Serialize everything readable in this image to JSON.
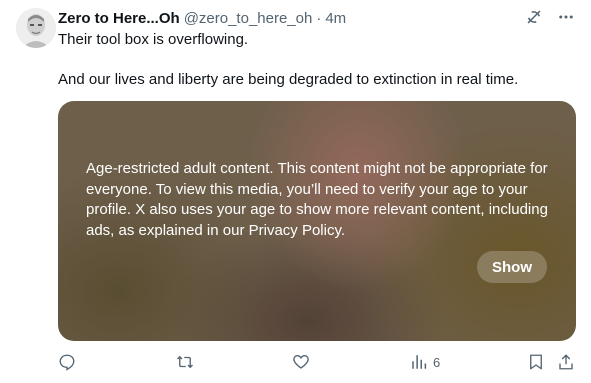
{
  "tweet": {
    "author_name": "Zero to Here...Oh",
    "author_handle": "@zero_to_here_oh",
    "separator": "·",
    "time": "4m",
    "text_lines": [
      "Their tool box is overflowing.",
      "And our lives and liberty are being degraded to extinction in real time."
    ]
  },
  "media_warning": {
    "message": "Age-restricted adult content. This content might not be appropriate for everyone. To view this media, you’ll need to verify your age to your profile. X also uses your age to show more relevant content, including ads, as explained in our Privacy Policy.",
    "show_label": "Show"
  },
  "actions": {
    "views_count": "6"
  },
  "icons": {
    "grok": "grok-icon",
    "more": "more-icon",
    "reply": "reply-icon",
    "retweet": "retweet-icon",
    "like": "like-icon",
    "views": "views-icon",
    "bookmark": "bookmark-icon",
    "share": "share-icon"
  },
  "colors": {
    "text_primary": "#0f1419",
    "text_secondary": "#536471"
  }
}
